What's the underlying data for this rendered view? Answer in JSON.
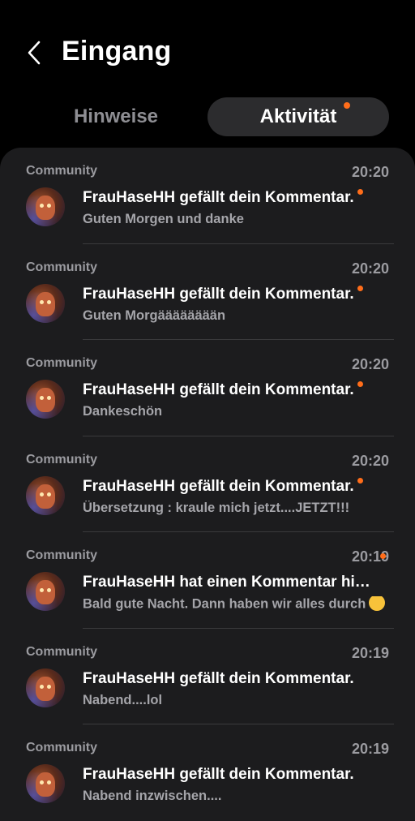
{
  "header": {
    "title": "Eingang",
    "back_icon": "chevron-left-icon"
  },
  "tabs": [
    {
      "label": "Hinweise",
      "active": false,
      "has_badge": false
    },
    {
      "label": "Aktivität",
      "active": true,
      "has_badge": true
    }
  ],
  "colors": {
    "accent_dot": "#ff6d1a",
    "background": "#000000",
    "card": "#1c1c1e"
  },
  "notifications": [
    {
      "source": "Community",
      "time": "20:20",
      "title": "FrauHaseHH gefällt dein Kommentar.",
      "subtitle": "Guten Morgen und danke",
      "unread": true
    },
    {
      "source": "Community",
      "time": "20:20",
      "title": "FrauHaseHH gefällt dein Kommentar.",
      "subtitle": "Guten Morgääääääään",
      "unread": true
    },
    {
      "source": "Community",
      "time": "20:20",
      "title": "FrauHaseHH gefällt dein Kommentar.",
      "subtitle": "Dankeschön",
      "unread": true
    },
    {
      "source": "Community",
      "time": "20:20",
      "title": "FrauHaseHH gefällt dein Kommentar.",
      "subtitle": "Übersetzung : kraule mich jetzt....JETZT!!!",
      "unread": true
    },
    {
      "source": "Community",
      "time": "20:19",
      "title": "FrauHaseHH hat einen Kommentar hin...",
      "subtitle": "Bald gute Nacht. Dann haben wir alles durch",
      "unread": true,
      "emoji": "winking-face-emoji"
    },
    {
      "source": "Community",
      "time": "20:19",
      "title": "FrauHaseHH gefällt dein Kommentar.",
      "subtitle": "Nabend....lol",
      "unread": false
    },
    {
      "source": "Community",
      "time": "20:19",
      "title": "FrauHaseHH gefällt dein Kommentar.",
      "subtitle": "Nabend inzwischen....",
      "unread": false
    }
  ]
}
